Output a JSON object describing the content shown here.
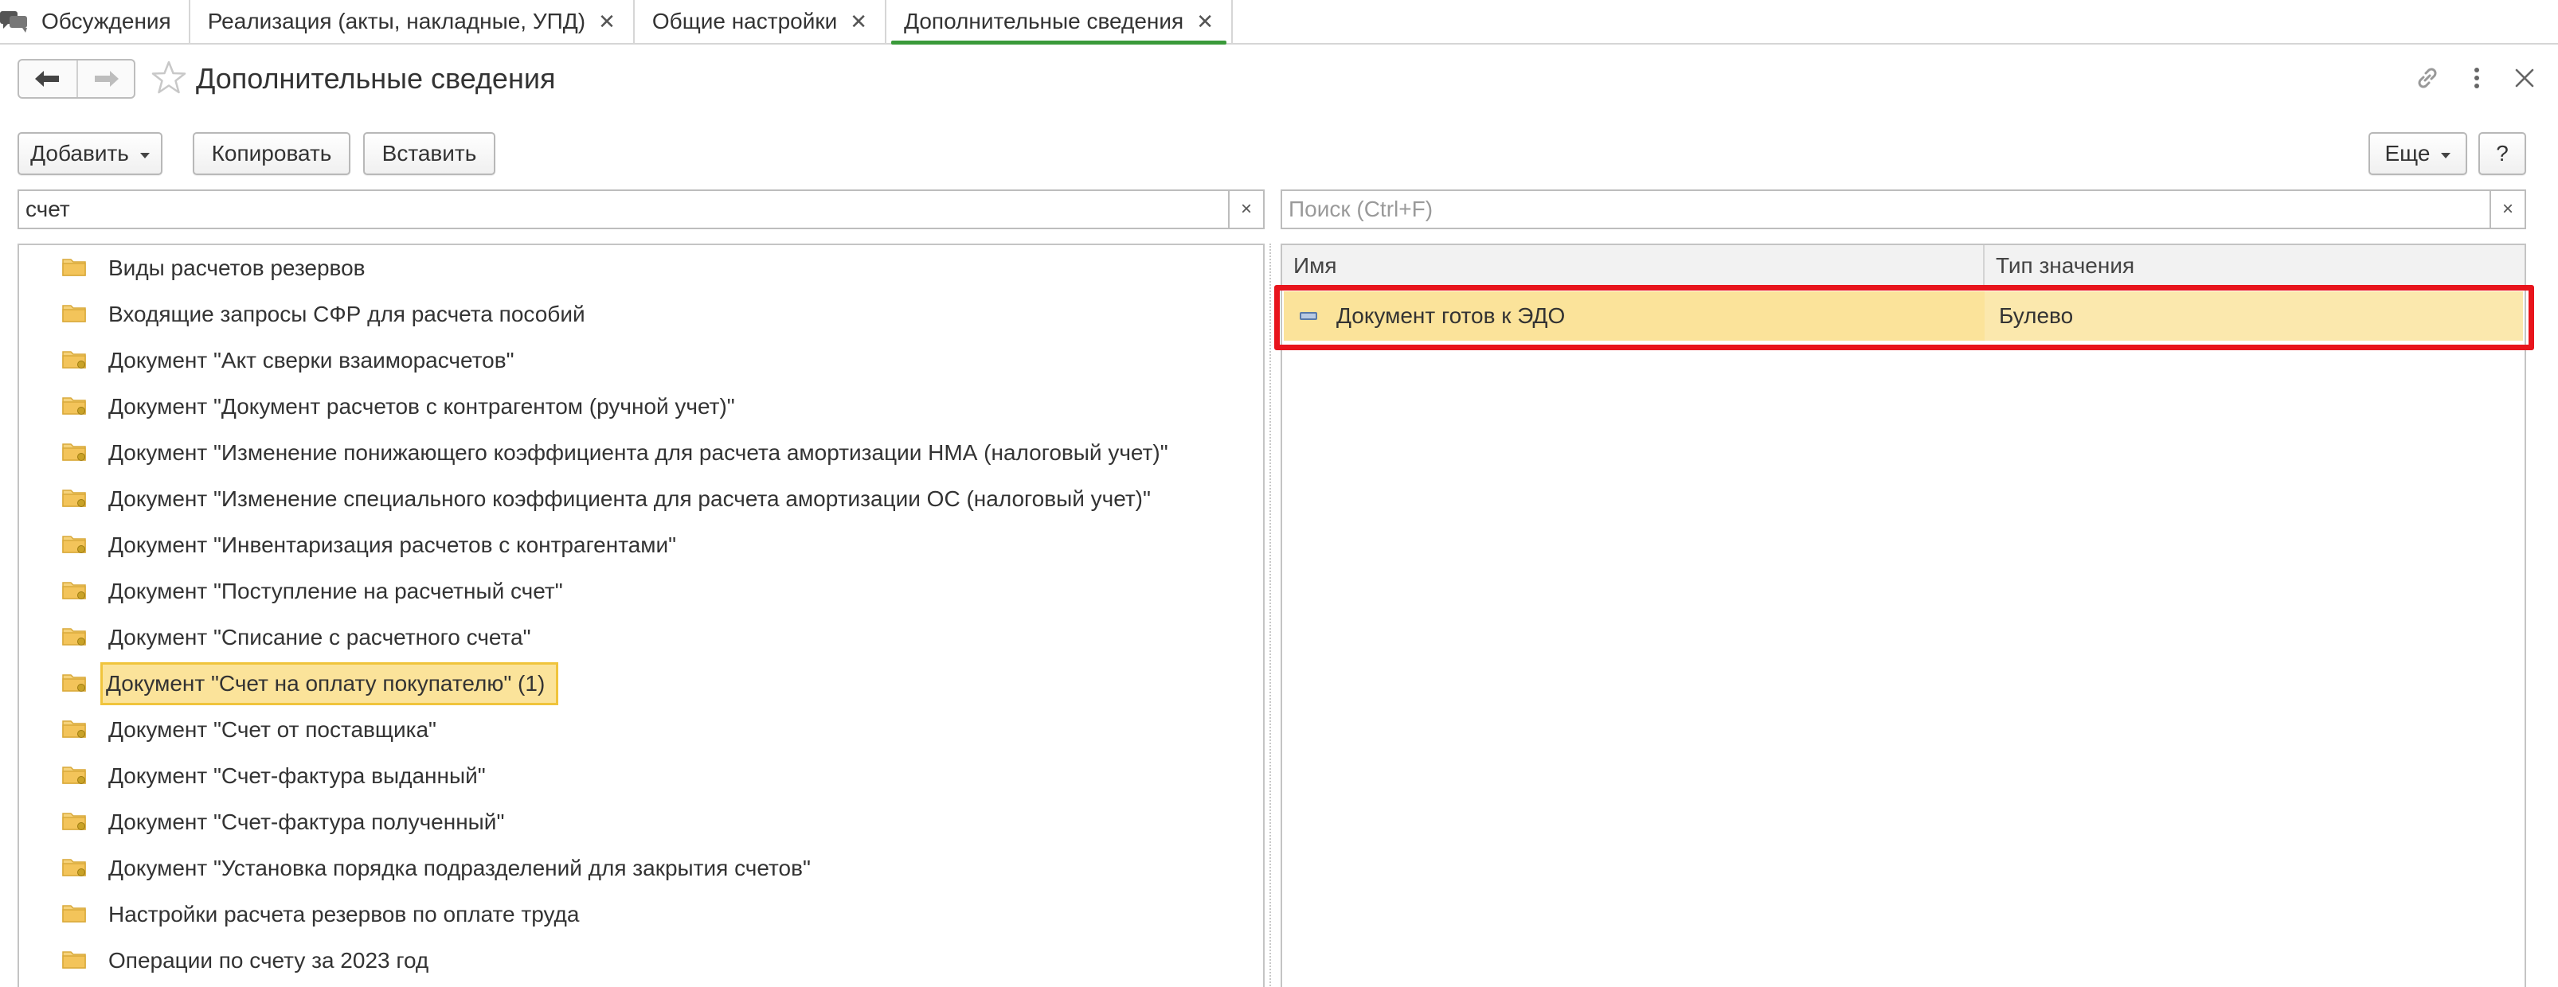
{
  "tabs": [
    {
      "label": "Обсуждения",
      "closable": false,
      "active": false
    },
    {
      "label": "Реализация (акты, накладные, УПД)",
      "closable": true,
      "active": false
    },
    {
      "label": "Общие настройки",
      "closable": true,
      "active": false
    },
    {
      "label": "Дополнительные сведения",
      "closable": true,
      "active": true
    }
  ],
  "header": {
    "title": "Дополнительные сведения",
    "icons": [
      "back-arrow-icon",
      "forward-arrow-icon",
      "favorite-star-icon",
      "link-icon",
      "more-vertical-icon",
      "close-icon"
    ]
  },
  "toolbar": {
    "add_label": "Добавить",
    "copy_label": "Копировать",
    "paste_label": "Вставить",
    "more_label": "Еще",
    "help_label": "?"
  },
  "left_search": {
    "value": "счет",
    "clear_symbol": "×"
  },
  "right_search": {
    "placeholder": "Поиск (Ctrl+F)",
    "clear_symbol": "×"
  },
  "tree": {
    "items": [
      {
        "label": "Виды расчетов резервов",
        "icon": "folder-icon"
      },
      {
        "label": "Входящие запросы СФР для расчета пособий",
        "icon": "folder-icon"
      },
      {
        "label": "Документ \"Акт сверки взаиморасчетов\"",
        "icon": "folder-doc-icon"
      },
      {
        "label": "Документ \"Документ расчетов с контрагентом (ручной учет)\"",
        "icon": "folder-doc-icon"
      },
      {
        "label": "Документ \"Изменение понижающего коэффициента для расчета амортизации НМА (налоговый учет)\"",
        "icon": "folder-doc-icon"
      },
      {
        "label": "Документ \"Изменение специального коэффициента для расчета амортизации ОС (налоговый учет)\"",
        "icon": "folder-doc-icon"
      },
      {
        "label": "Документ \"Инвентаризация расчетов с контрагентами\"",
        "icon": "folder-doc-icon"
      },
      {
        "label": "Документ \"Поступление на расчетный счет\"",
        "icon": "folder-doc-icon"
      },
      {
        "label": "Документ \"Списание с расчетного счета\"",
        "icon": "folder-doc-icon"
      },
      {
        "label": "Документ \"Счет на оплату покупателю\" (1)",
        "icon": "folder-doc-icon",
        "selected": true
      },
      {
        "label": "Документ \"Счет от поставщика\"",
        "icon": "folder-doc-icon"
      },
      {
        "label": "Документ \"Счет-фактура выданный\"",
        "icon": "folder-doc-icon"
      },
      {
        "label": "Документ \"Счет-фактура полученный\"",
        "icon": "folder-doc-icon"
      },
      {
        "label": "Документ \"Установка порядка подразделений для закрытия счетов\"",
        "icon": "folder-doc-icon"
      },
      {
        "label": "Настройки расчета резервов по оплате труда",
        "icon": "folder-icon"
      },
      {
        "label": "Операции по счету за 2023 год",
        "icon": "folder-icon"
      }
    ]
  },
  "table": {
    "columns": [
      "Имя",
      "Тип значения"
    ],
    "rows": [
      {
        "name": "Документ готов к ЭДО",
        "type": "Булево",
        "icon": "property-icon"
      }
    ]
  },
  "colors": {
    "active_tab_underline": "#3a9a3a",
    "selection_fill": "#fbe39a",
    "selection_border": "#f0c43c",
    "annotation_red": "#e8141c",
    "folder_yellow": "#f3c45a"
  }
}
